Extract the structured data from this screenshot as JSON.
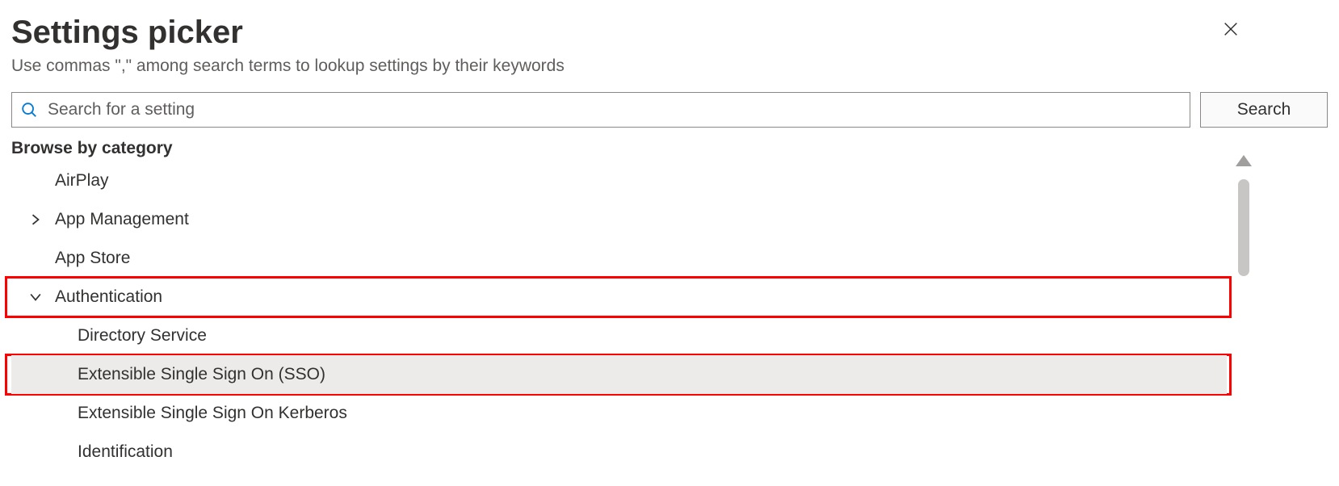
{
  "header": {
    "title": "Settings picker",
    "subtitle": "Use commas \",\" among search terms to lookup settings by their keywords"
  },
  "search": {
    "placeholder": "Search for a setting",
    "value": "",
    "button_label": "Search"
  },
  "browse": {
    "label": "Browse by category",
    "categories": [
      {
        "label": "AirPlay",
        "has_children": false,
        "expanded": false
      },
      {
        "label": "App Management",
        "has_children": true,
        "expanded": false
      },
      {
        "label": "App Store",
        "has_children": false,
        "expanded": false
      },
      {
        "label": "Authentication",
        "has_children": true,
        "expanded": true,
        "children": [
          {
            "label": "Directory Service",
            "selected": false
          },
          {
            "label": "Extensible Single Sign On (SSO)",
            "selected": true
          },
          {
            "label": "Extensible Single Sign On Kerberos",
            "selected": false
          },
          {
            "label": "Identification",
            "selected": false
          }
        ]
      }
    ]
  },
  "highlights": {
    "authentication_row": true,
    "esso_row": true
  }
}
